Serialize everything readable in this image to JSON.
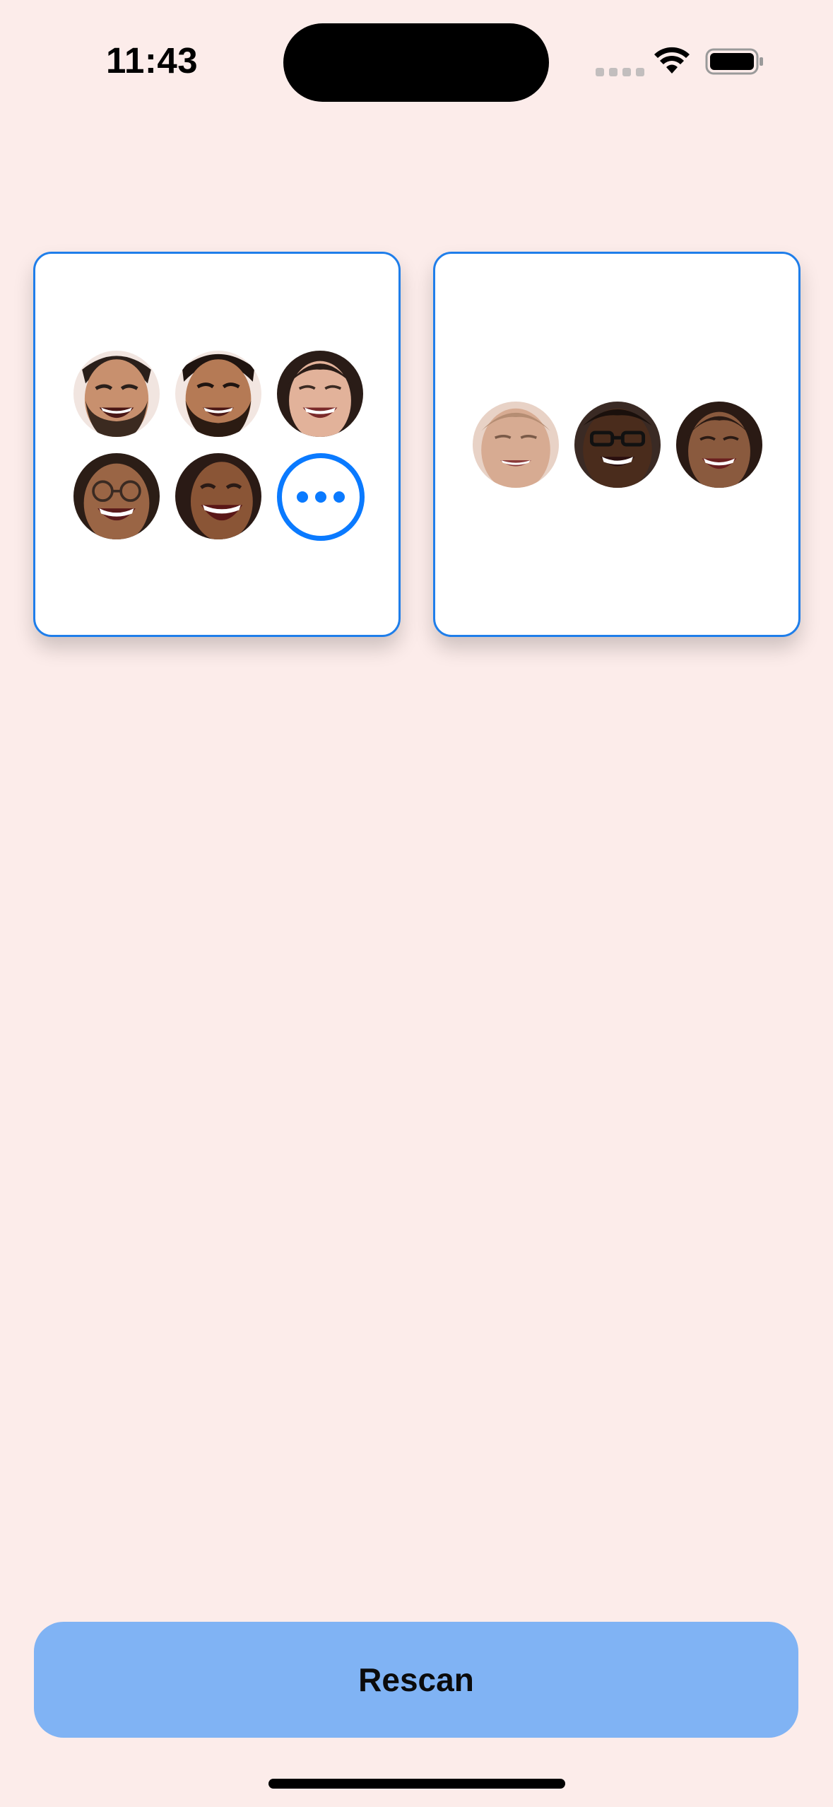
{
  "status_bar": {
    "time": "11:43",
    "wifi_icon": "wifi-icon",
    "battery_icon": "battery-icon"
  },
  "groups": [
    {
      "faces": [
        {
          "icon": "face-man-beard-smiling"
        },
        {
          "icon": "face-man-beard-smiling"
        },
        {
          "icon": "face-woman-smiling"
        },
        {
          "icon": "face-woman-glasses-smiling"
        },
        {
          "icon": "face-woman-laughing"
        }
      ],
      "more_icon": "more-icon"
    },
    {
      "faces": [
        {
          "icon": "face-woman-smiling"
        },
        {
          "icon": "face-man-glasses-smiling"
        },
        {
          "icon": "face-woman-smiling"
        }
      ]
    }
  ],
  "rescan_button": {
    "label": "Rescan"
  },
  "colors": {
    "background": "#FCECEA",
    "card_border": "#1F7EEA",
    "accent": "#0A7AFF",
    "button": "#80B3F4"
  }
}
